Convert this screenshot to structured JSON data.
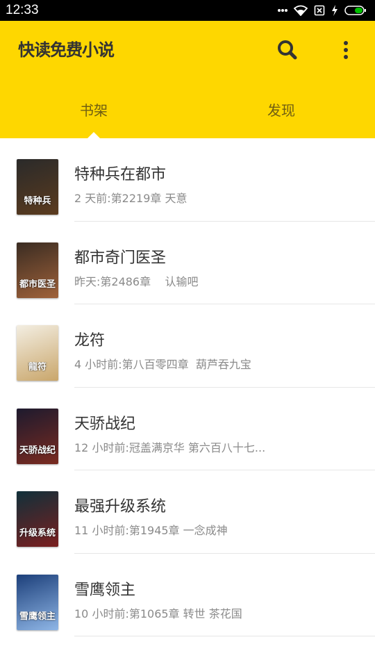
{
  "status_bar": {
    "time": "12:33",
    "icons": [
      "more-dots-icon",
      "wifi-icon",
      "sim-off-icon",
      "charging-icon",
      "battery-icon"
    ],
    "battery_color": "#00c000"
  },
  "app_bar": {
    "title": "快读免费小说",
    "background": "#fed700",
    "actions": [
      "search-icon",
      "more-vert-icon"
    ]
  },
  "tabs": [
    {
      "label": "书架",
      "selected": true
    },
    {
      "label": "发现",
      "selected": false
    }
  ],
  "books": [
    {
      "title": "特种兵在都市",
      "meta": "2 天前:第2219章 天意",
      "cover_text": "特种兵",
      "cover_colors": [
        "#2a2a2a",
        "#5b3b1e"
      ]
    },
    {
      "title": "都市奇门医圣",
      "meta": "昨天:第2486章    认输吧",
      "cover_text": "都市医圣",
      "cover_colors": [
        "#3a2c22",
        "#a0623a"
      ]
    },
    {
      "title": "龙符",
      "meta": "4 小时前:第八百零四章  葫芦吞九宝",
      "cover_text": "龍符",
      "cover_colors": [
        "#f3eee2",
        "#c9a66b"
      ]
    },
    {
      "title": "天骄战纪",
      "meta": "12 小时前:冠盖满京华 第六百八十七...",
      "cover_text": "天骄战纪",
      "cover_colors": [
        "#1d1a2e",
        "#7a2b20"
      ]
    },
    {
      "title": "最强升级系统",
      "meta": "11 小时前:第1945章 一念成神",
      "cover_text": "升级系统",
      "cover_colors": [
        "#10303a",
        "#7a1f1f"
      ]
    },
    {
      "title": "雪鹰领主",
      "meta": "10 小时前:第1065章 转世 茶花国",
      "cover_text": "雪鹰领主",
      "cover_colors": [
        "#1c3f7a",
        "#8fb6e6"
      ]
    }
  ]
}
